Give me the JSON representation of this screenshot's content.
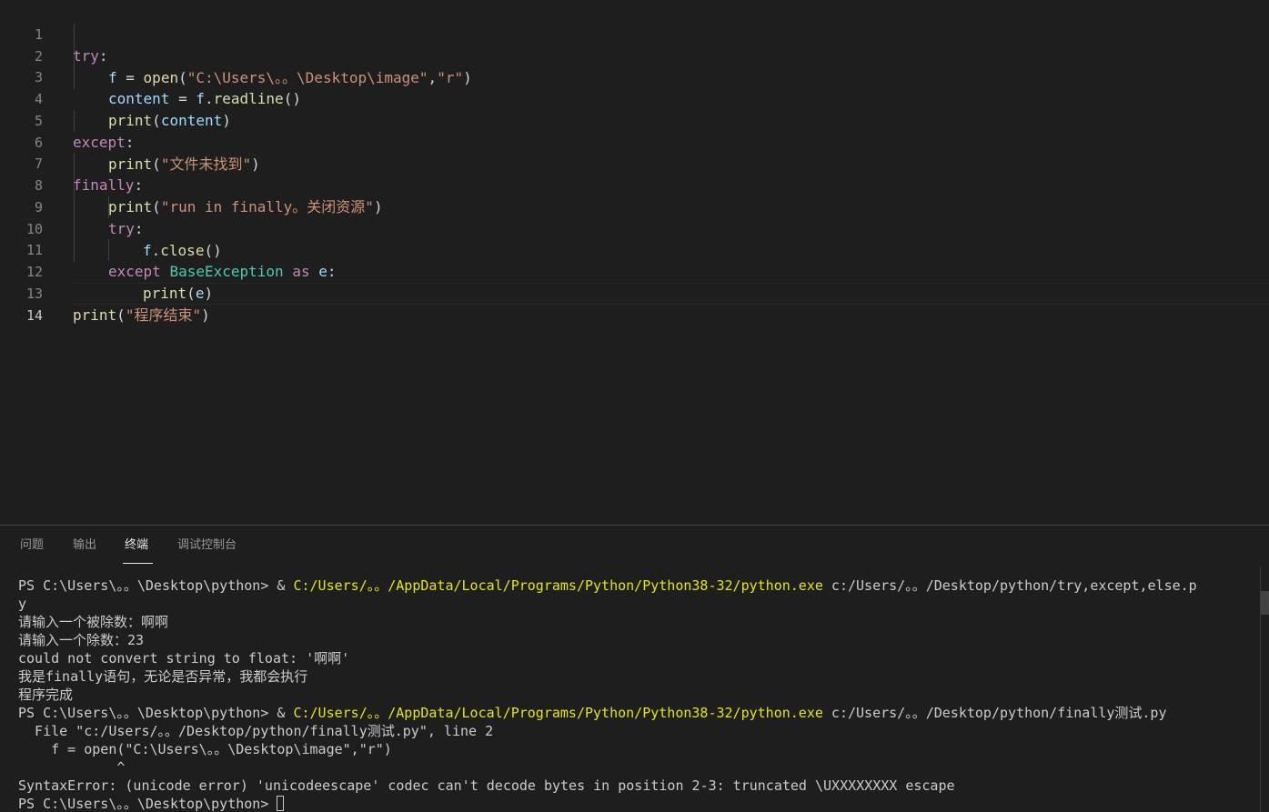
{
  "editor": {
    "line_numbers": [
      "1",
      "2",
      "3",
      "4",
      "5",
      "6",
      "7",
      "8",
      "9",
      "10",
      "11",
      "12",
      "13",
      "14"
    ],
    "active_line": "14",
    "code": {
      "l1_try": "try",
      "l1_colon": ":",
      "l2_f": "f",
      "l2_eq": " = ",
      "l2_open": "open",
      "l2_paren_open": "(",
      "l2_path": "\"C:\\Users\\。。\\Desktop\\image\"",
      "l2_comma": ",",
      "l2_mode": "\"r\"",
      "l2_paren_close": ")",
      "l3_content": "content",
      "l3_eq": " = ",
      "l3_f": "f",
      "l3_dot": ".",
      "l3_readline": "readline",
      "l3_parens": "()",
      "l4_print": "print",
      "l4_open": "(",
      "l4_content": "content",
      "l4_close": ")",
      "l5_except": "except",
      "l5_colon": ":",
      "l6_print": "print",
      "l6_open": "(",
      "l6_str": "\"文件未找到\"",
      "l6_close": ")",
      "l7_finally": "finally",
      "l7_colon": ":",
      "l8_print": "print",
      "l8_open": "(",
      "l8_str": "\"run in finally。关闭资源\"",
      "l8_close": ")",
      "l9_try": "try",
      "l9_colon": ":",
      "l10_f": "f",
      "l10_dot": ".",
      "l10_close": "close",
      "l10_parens": "()",
      "l11_except": "except",
      "l11_cls": "BaseException",
      "l11_as": "as",
      "l11_e": "e",
      "l11_colon": ":",
      "l12_print": "print",
      "l12_open": "(",
      "l12_e": "e",
      "l12_close": ")",
      "l13_print": "print",
      "l13_open": "(",
      "l13_str": "\"程序结束\"",
      "l13_close": ")"
    }
  },
  "panel": {
    "tabs": [
      {
        "label": "问题"
      },
      {
        "label": "输出"
      },
      {
        "label": "终端"
      },
      {
        "label": "调试控制台"
      }
    ],
    "active_tab": "终端"
  },
  "terminal": {
    "l1_prompt": "PS C:\\Users\\。。\\Desktop\\python> & ",
    "l1_exe": "C:/Users/。。/AppData/Local/Programs/Python/Python38-32/python.exe",
    "l1_args": " c:/Users/。。/Desktop/python/try,except,else.p",
    "l2": "y",
    "l3": "请输入一个被除数：啊啊",
    "l4": "请输入一个除数：23",
    "l5": "could not convert string to float: '啊啊'",
    "l6": "我是finally语句，无论是否异常，我都会执行",
    "l7": "程序完成",
    "l8_prompt": "PS C:\\Users\\。。\\Desktop\\python> & ",
    "l8_exe": "C:/Users/。。/AppData/Local/Programs/Python/Python38-32/python.exe",
    "l8_args": " c:/Users/。。/Desktop/python/finally测试.py",
    "l9": "  File \"c:/Users/。。/Desktop/python/finally测试.py\", line 2",
    "l10": "    f = open(\"C:\\Users\\。。\\Desktop\\image\",\"r\")",
    "l11": "            ^",
    "l12": "SyntaxError: (unicode error) 'unicodeescape' codec can't decode bytes in position 2-3: truncated \\UXXXXXXXX escape",
    "l13_prompt": "PS C:\\Users\\。。\\Desktop\\python> "
  }
}
